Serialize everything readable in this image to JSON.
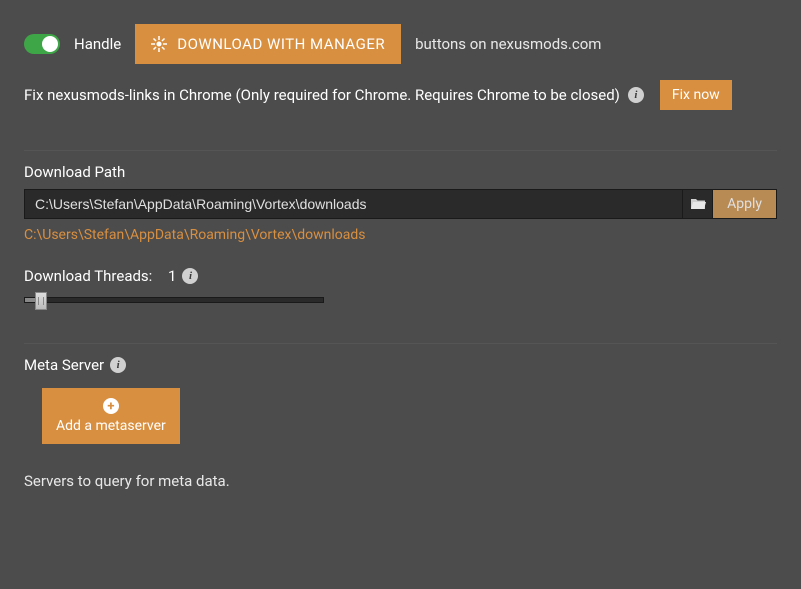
{
  "handle": {
    "toggle_label": "Handle",
    "download_button": "DOWNLOAD WITH MANAGER",
    "suffix_text": "buttons on nexusmods.com"
  },
  "chrome_fix": {
    "text": "Fix nexusmods-links in Chrome (Only required for Chrome. Requires Chrome to be closed)",
    "button": "Fix now"
  },
  "download_path": {
    "label": "Download Path",
    "value": "C:\\Users\\Stefan\\AppData\\Roaming\\Vortex\\downloads",
    "apply_label": "Apply",
    "resolved": "C:\\Users\\Stefan\\AppData\\Roaming\\Vortex\\downloads"
  },
  "threads": {
    "label": "Download Threads:",
    "value": "1"
  },
  "meta": {
    "label": "Meta Server",
    "add_button": "Add a metaserver",
    "desc": "Servers to query for meta data."
  }
}
